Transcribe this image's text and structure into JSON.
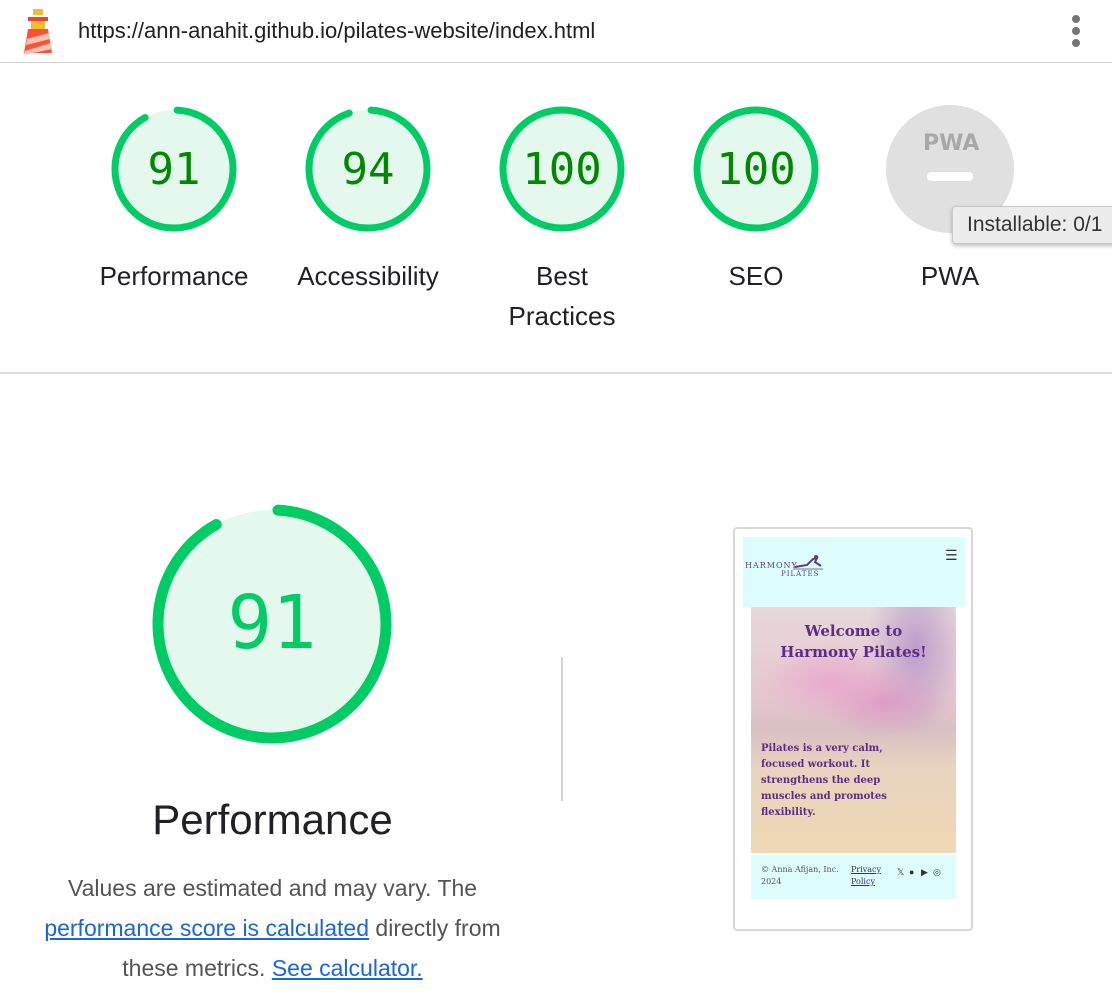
{
  "url_bar": {
    "url": "https://ann-anahit.github.io/pilates-website/index.html"
  },
  "categories": [
    {
      "label": "Performance",
      "score": 91
    },
    {
      "label": "Accessibility",
      "score": 94
    },
    {
      "label": "Best\nPractices",
      "label_line1": "Best",
      "label_line2": "Practices",
      "score": 100
    },
    {
      "label": "SEO",
      "score": 100
    },
    {
      "label": "PWA",
      "score_text": "PWA",
      "badge": "PWA"
    }
  ],
  "tooltip": {
    "text": "Installable: 0/1"
  },
  "performance": {
    "score": 91,
    "title": "Performance",
    "desc_part1": "Values are estimated and may vary. The ",
    "desc_link1": "performance score is calculated",
    "desc_part2": " directly from these metrics. ",
    "desc_link2": "See calculator."
  },
  "screenshot": {
    "brand_line1": "HARMONY",
    "brand_line2": "PILATES",
    "menu_icon": "☰",
    "hero_title_line1": "Welcome to",
    "hero_title_line2": "Harmony Pilates!",
    "hero_text": "Pilates is a very calm, focused workout. It strengthens the deep muscles and promotes flexibility.",
    "footer_copy": "© Anna Afijan, Inc. 2024",
    "footer_privacy_line1": "Privacy",
    "footer_privacy_line2": "Policy",
    "social_icons": [
      "x-icon",
      "facebook-icon",
      "youtube-icon",
      "instagram-icon"
    ]
  },
  "colors": {
    "pass_ring": "#00cc66",
    "pass_fill": "#e5f8ee",
    "pass_text": "#008800",
    "pwa_gray": "#e0e0e0",
    "link": "#1a64e0"
  }
}
